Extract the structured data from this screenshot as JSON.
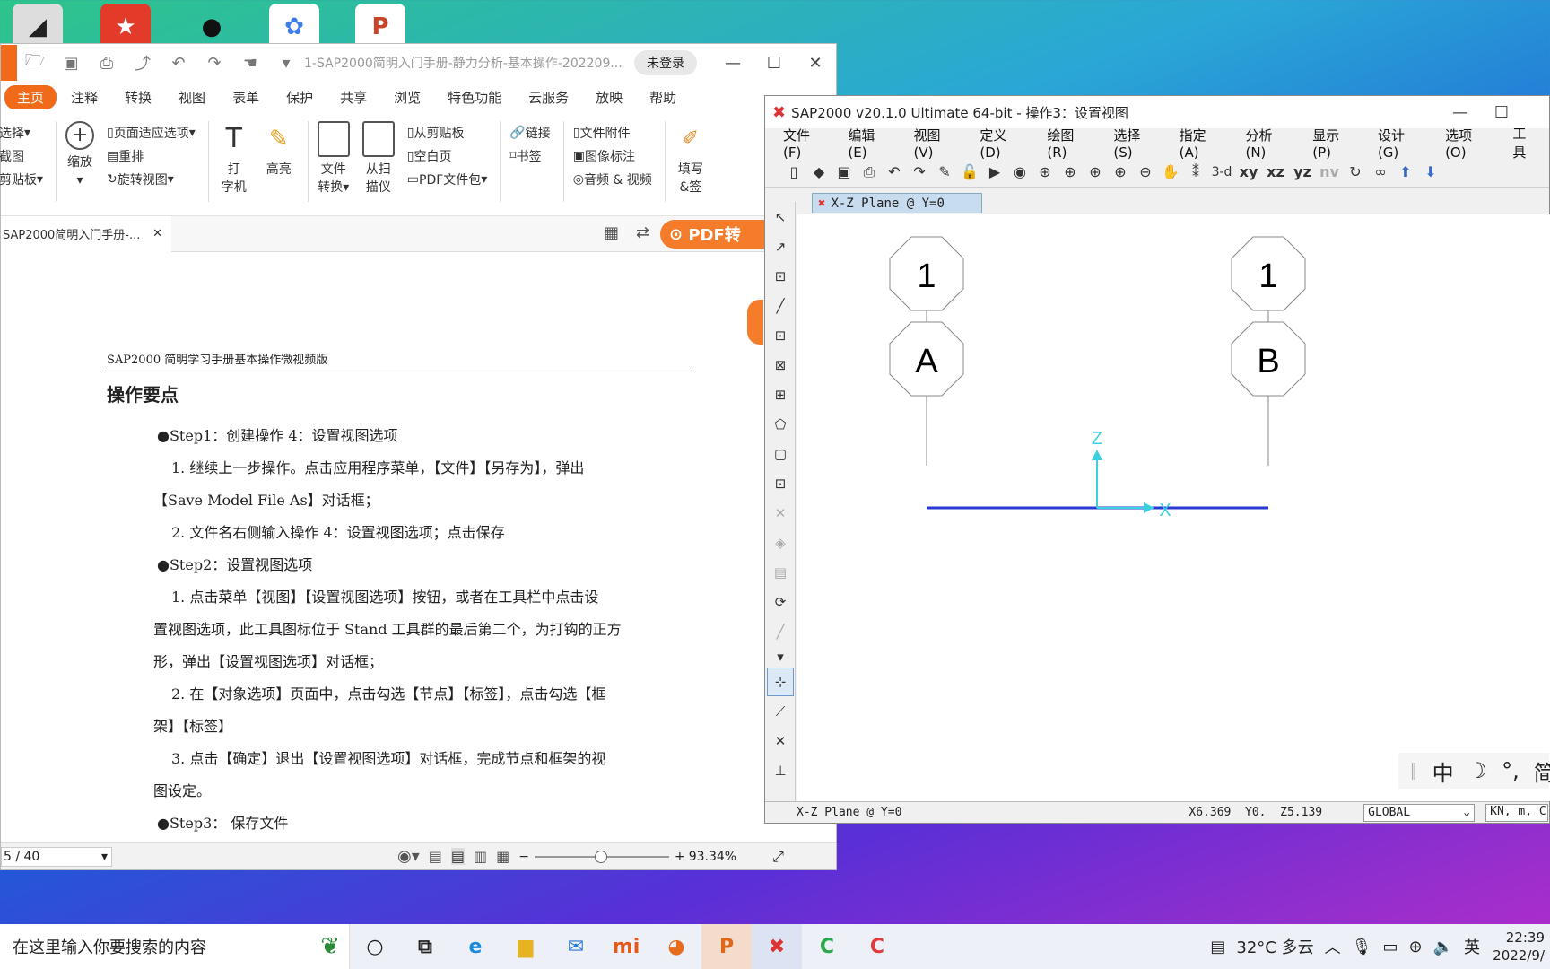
{
  "colors": {
    "accent": "#f06a1a",
    "sap_blue": "#2a3ad0",
    "axis_cyan": "#3bd0e0"
  },
  "pdf": {
    "doc_title": "1-SAP2000简明入门手册-静力分析-基本操作-202209...",
    "login": "未登录",
    "menu": [
      "主页",
      "注释",
      "转换",
      "视图",
      "表单",
      "保护",
      "共享",
      "浏览",
      "特色功能",
      "云服务",
      "放映",
      "帮助"
    ],
    "ribbon": {
      "left_col": [
        "选择",
        "截图",
        "剪贴板"
      ],
      "zoom": "缩放",
      "page_col": [
        "页面适应选项",
        "重排",
        "旋转视图"
      ],
      "typewriter": [
        "打",
        "字机"
      ],
      "highlight": "高亮",
      "file_convert": [
        "文件",
        "转换"
      ],
      "from_scan": [
        "从扫",
        "描仪"
      ],
      "clip_col": [
        "从剪贴板",
        "空白页",
        "PDF文件包"
      ],
      "link_col": [
        "链接",
        "书签"
      ],
      "attach_col": [
        "文件附件",
        "图像标注",
        "音频 & 视频"
      ],
      "fill_sign": [
        "填写",
        "&签"
      ]
    },
    "tab_name": "SAP2000简明入门手册-...",
    "promo": "PDF转",
    "page": {
      "header": "SAP2000 简明学习手册基本操作微视频版",
      "title": "操作要点",
      "lines": [
        "●Step1：创建操作 4：设置视图选项",
        "　1. 继续上一步操作。点击应用程序菜单，【文件】【另存为】，弹出",
        "【Save Model File As】对话框；",
        "　2. 文件名右侧输入操作 4：设置视图选项；点击保存",
        "●Step2：设置视图选项",
        "　1. 点击菜单【视图】【设置视图选项】按钮，或者在工具栏中点击设",
        "置视图选项，此工具图标位于 Stand 工具群的最后第二个，为打钩的正方",
        "形，弹出【设置视图选项】对话框；",
        "　2. 在【对象选项】页面中，点击勾选【节点】【标签】，点击勾选【框",
        "架】【标签】",
        "　3. 点击【确定】退出【设置视图选项】对话框，完成节点和框架的视",
        "图设定。",
        "●Step3： 保存文件"
      ]
    },
    "status": {
      "page": "5 / 40",
      "zoom": "93.34%",
      "zoom_level": 0.45
    }
  },
  "sap": {
    "title": "SAP2000 v20.1.0 Ultimate 64-bit - 操作3：设置视图",
    "menu": [
      "文件(F)",
      "编辑(E)",
      "视图(V)",
      "定义(D)",
      "绘图(R)",
      "选择(S)",
      "指定(A)",
      "分析(N)",
      "显示(P)",
      "设计(G)",
      "选项(O)",
      "工具"
    ],
    "toolbar_text": [
      "3-d",
      "xy",
      "xz",
      "yz",
      "nv"
    ],
    "view_tab": "X-Z Plane @ Y=0",
    "grid": {
      "left_top": "1",
      "left_bottom": "A",
      "right_top": "1",
      "right_bottom": "B"
    },
    "axes": {
      "z": "Z",
      "x": "X"
    },
    "status": {
      "view": "X-Z Plane @ Y=0",
      "coords": "X6.369  Y0.  Z5.139",
      "csys": "GLOBAL",
      "units": "KN, m, C"
    },
    "ime": [
      "中",
      "简"
    ]
  },
  "taskbar": {
    "search": "在这里输入你要搜索的内容",
    "weather": "32°C 多云",
    "lang": "英",
    "time": "22:39",
    "date": "2022/9/"
  }
}
